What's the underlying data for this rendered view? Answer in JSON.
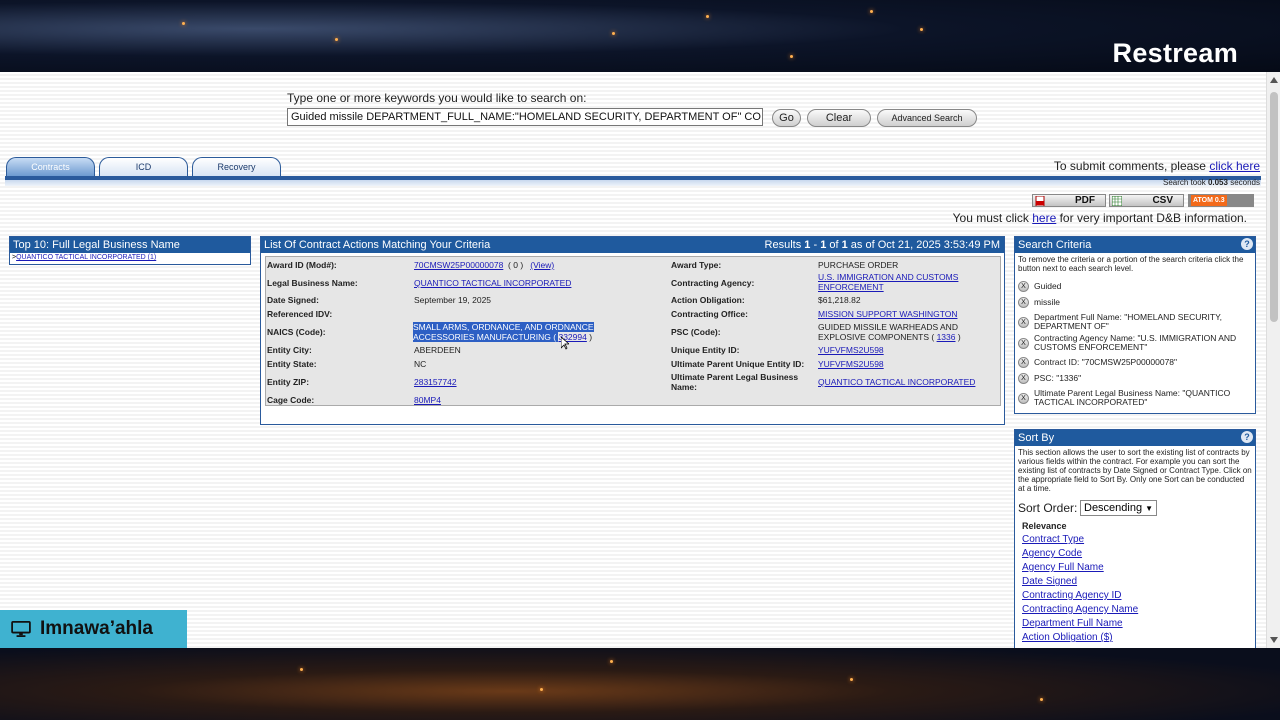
{
  "stream": {
    "brand": "Restream",
    "overlay_name": "Imnawa’ahla"
  },
  "search": {
    "prompt": "Type one or more keywords you would like to search on:",
    "query": "Guided missile DEPARTMENT_FULL_NAME:\"HOMELAND SECURITY, DEPARTMENT OF\" CO",
    "go_label": "Go",
    "clear_label": "Clear",
    "advanced_label": "Advanced Search"
  },
  "tabs": [
    {
      "label": "Contracts",
      "active": true
    },
    {
      "label": "ICD",
      "active": false
    },
    {
      "label": "Recovery",
      "active": false
    }
  ],
  "comments": {
    "text": "To submit comments, please ",
    "link": "click here"
  },
  "search_time": {
    "prefix": "Search took ",
    "value": "0.053",
    "suffix": " seconds"
  },
  "exports": {
    "pdf": "PDF",
    "csv": "CSV",
    "atom": "ATOM 0.3"
  },
  "dnb_notice": {
    "pre": "You must click ",
    "link": "here",
    "post": " for very important D&B information."
  },
  "top10": {
    "title": "Top 10: Full Legal Business Name",
    "items": [
      "QUANTICO TACTICAL INCORPORATED (1)"
    ]
  },
  "results": {
    "title": "List Of Contract Actions Matching Your Criteria",
    "summary_pre": "Results ",
    "range_start": "1",
    "range_end": "1",
    "total": "1",
    "summary_post": " as of Oct 21, 2025 3:53:49 PM",
    "record": {
      "award_id_label": "Award ID (Mod#):",
      "award_id": "70CMSW25P00000078",
      "mod": "( 0 )",
      "view": "(View)",
      "legal_business_name_label": "Legal Business Name:",
      "legal_business_name": "QUANTICO TACTICAL INCORPORATED",
      "date_signed_label": "Date Signed:",
      "date_signed": "September 19, 2025",
      "referenced_idv_label": "Referenced IDV:",
      "naics_label": "NAICS (Code):",
      "naics_line1": "SMALL ARMS, ORDNANCE, AND ORDNANCE",
      "naics_line2": "ACCESSORIES MANUFACTURING",
      "naics_code": "332994",
      "entity_city_label": "Entity City:",
      "entity_city": "ABERDEEN",
      "entity_state_label": "Entity State:",
      "entity_state": "NC",
      "entity_zip_label": "Entity ZIP:",
      "entity_zip": "283157742",
      "cage_code_label": "Cage Code:",
      "cage_code": "80MP4",
      "award_type_label": "Award Type:",
      "award_type": "PURCHASE ORDER",
      "contracting_agency_label": "Contracting Agency:",
      "contracting_agency_line1": "U.S. IMMIGRATION AND CUSTOMS",
      "contracting_agency_line2": "ENFORCEMENT",
      "action_obligation_label": "Action Obligation:",
      "action_obligation": "$61,218.82",
      "contracting_office_label": "Contracting Office:",
      "contracting_office": "MISSION SUPPORT WASHINGTON",
      "psc_label": "PSC (Code):",
      "psc_line1": "GUIDED MISSILE WARHEADS AND",
      "psc_line2": "EXPLOSIVE COMPONENTS (",
      "psc_code": "1336",
      "uei_label": "Unique Entity ID:",
      "uei": "YUFVFMS2U598",
      "ult_parent_uei_label": "Ultimate Parent Unique Entity ID:",
      "ult_parent_uei": "YUFVFMS2U598",
      "ult_parent_name_label_1": "Ultimate Parent Legal Business",
      "ult_parent_name_label_2": "Name:",
      "ult_parent_name": "QUANTICO TACTICAL INCORPORATED"
    }
  },
  "criteria": {
    "title": "Search Criteria",
    "help": "?",
    "instructions": "To remove the criteria or a portion of the search criteria click the button next to each search level.",
    "remove_glyph": "X",
    "items": [
      [
        "Guided"
      ],
      [
        "missile"
      ],
      [
        "Department Full Name: \"HOMELAND SECURITY,",
        "DEPARTMENT OF\""
      ],
      [
        "Contracting Agency Name: \"U.S. IMMIGRATION AND",
        "CUSTOMS ENFORCEMENT\""
      ],
      [
        "Contract ID: \"70CMSW25P00000078\""
      ],
      [
        "PSC: \"1336\""
      ],
      [
        "Ultimate Parent Legal Business Name: \"QUANTICO",
        "TACTICAL INCORPORATED\""
      ]
    ]
  },
  "sort": {
    "title": "Sort By",
    "help": "?",
    "description": "This section allows the user to sort the existing list of contracts by various fields within the contract. For example you can sort the existing list of contracts by Date Signed or Contract Type. Click on the appropriate field to Sort By. Only one Sort can be conducted at a time.",
    "order_label": "Sort Order:",
    "order_value": "Descending",
    "current": "Relevance",
    "fields": [
      "Contract Type",
      "Agency Code",
      "Agency Full Name",
      "Date Signed",
      "Contracting Agency ID",
      "Contracting Agency Name",
      "Department Full Name",
      "Action Obligation ($)"
    ]
  }
}
